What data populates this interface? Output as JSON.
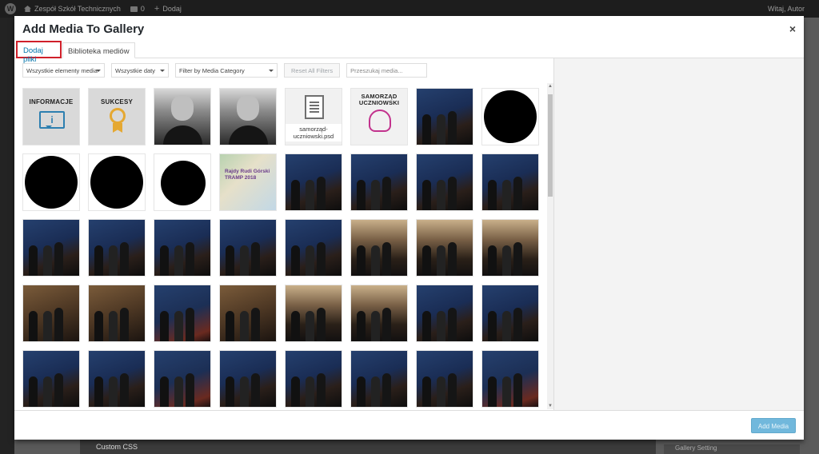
{
  "adminbar": {
    "site_name": "Zespół Szkół Technicznych",
    "comments_count": "0",
    "new_label": "Dodaj",
    "greeting": "Witaj, Autor"
  },
  "background": {
    "section_label": "Custom CSS",
    "right_label": "Gallery Setting"
  },
  "modal": {
    "title": "Add Media To Gallery",
    "close_glyph": "×",
    "tabs": [
      {
        "label": "Dodaj pliki",
        "active": true
      },
      {
        "label": "Biblioteka mediów",
        "active": false
      }
    ],
    "filters": {
      "type": "Wszystkie elementy media",
      "date": "Wszystkie daty",
      "category": "Filter by Media Category",
      "reset": "Reset All Filters",
      "search_placeholder": "Przeszukaj media..."
    },
    "footer": {
      "add_button": "Add Media"
    }
  },
  "media_items": [
    {
      "kind": "info",
      "title": "INFORMACJE"
    },
    {
      "kind": "sukcesy",
      "title": "SUKCESY"
    },
    {
      "kind": "bw"
    },
    {
      "kind": "bw"
    },
    {
      "kind": "file",
      "filename": "samorząd-uczniowski.psd"
    },
    {
      "kind": "samorzad",
      "title": "SAMORZĄD UCZNIOWSKI"
    },
    {
      "kind": "photo"
    },
    {
      "kind": "circle"
    },
    {
      "kind": "circle"
    },
    {
      "kind": "circle"
    },
    {
      "kind": "circle-small"
    },
    {
      "kind": "map",
      "text": "Rajdy Rudi Górski TRAMP 2018"
    },
    {
      "kind": "photo"
    },
    {
      "kind": "photo"
    },
    {
      "kind": "photo"
    },
    {
      "kind": "photo"
    },
    {
      "kind": "photo"
    },
    {
      "kind": "photo"
    },
    {
      "kind": "photo"
    },
    {
      "kind": "photo"
    },
    {
      "kind": "photo"
    },
    {
      "kind": "hall"
    },
    {
      "kind": "hall"
    },
    {
      "kind": "hall"
    },
    {
      "kind": "warm"
    },
    {
      "kind": "warm"
    },
    {
      "kind": "red"
    },
    {
      "kind": "warm"
    },
    {
      "kind": "hall"
    },
    {
      "kind": "hall"
    },
    {
      "kind": "photo"
    },
    {
      "kind": "photo"
    },
    {
      "kind": "photo"
    },
    {
      "kind": "photo"
    },
    {
      "kind": "red"
    },
    {
      "kind": "photo"
    },
    {
      "kind": "photo"
    },
    {
      "kind": "photo"
    },
    {
      "kind": "photo"
    },
    {
      "kind": "red"
    }
  ],
  "colors": {
    "accent": "#0073aa",
    "highlight_border": "#d0202a",
    "button": "#71b8dc"
  },
  "icons": {
    "close": "close-icon",
    "wordpress": "wordpress-logo-icon",
    "home": "home-icon",
    "comments": "comment-icon",
    "new": "plus-icon"
  }
}
